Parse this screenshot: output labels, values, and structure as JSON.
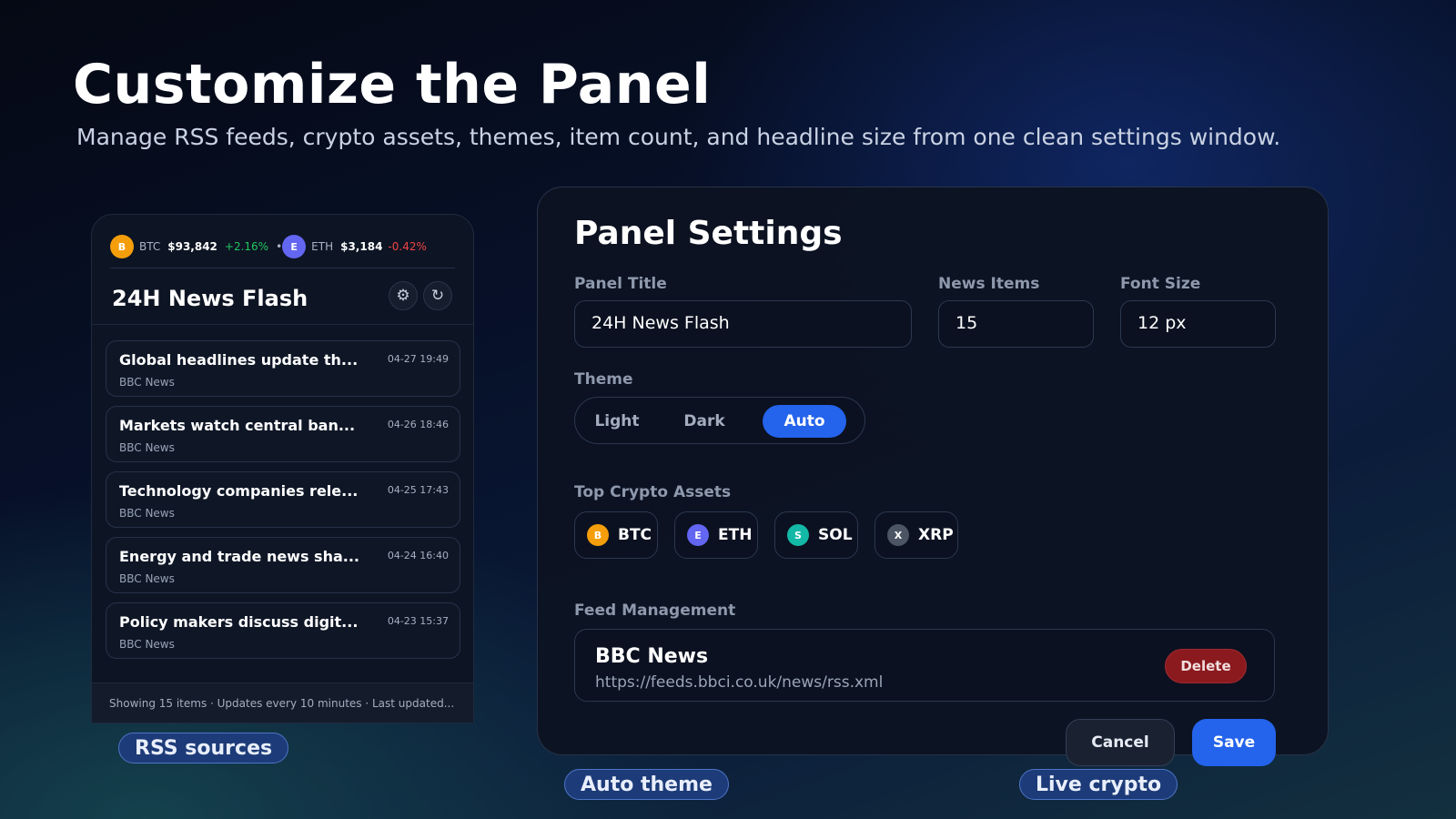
{
  "hero": {
    "title": "Customize the Panel",
    "subtitle": "Manage RSS feeds, crypto assets, themes, item count, and headline size from one clean settings window."
  },
  "widget": {
    "ticker": [
      {
        "badge": "B",
        "symbol": "BTC",
        "price": "$93,842",
        "change": "+2.16%",
        "direction": "up",
        "color": "#f59e0b"
      },
      {
        "badge": "E",
        "symbol": "ETH",
        "price": "$3,184",
        "change": "-0.42%",
        "direction": "down",
        "color": "#6366f1"
      }
    ],
    "ticker_separator": "•",
    "title": "24H News Flash",
    "settings_icon": "⚙",
    "refresh_icon": "↻",
    "news": [
      {
        "title": "Global headlines update th...",
        "source": "BBC News",
        "time": "04-27 19:49"
      },
      {
        "title": "Markets watch central ban...",
        "source": "BBC News",
        "time": "04-26 18:46"
      },
      {
        "title": "Technology companies rele...",
        "source": "BBC News",
        "time": "04-25 17:43"
      },
      {
        "title": "Energy and trade news sha...",
        "source": "BBC News",
        "time": "04-24 16:40"
      },
      {
        "title": "Policy makers discuss digit...",
        "source": "BBC News",
        "time": "04-23 15:37"
      }
    ],
    "footer": "Showing 15 items · Updates every 10 minutes · Last updated..."
  },
  "pills": {
    "rss": "RSS sources",
    "theme": "Auto theme",
    "crypto": "Live crypto"
  },
  "settings": {
    "title": "Panel Settings",
    "panel_title_label": "Panel Title",
    "panel_title_value": "24H News Flash",
    "news_items_label": "News Items",
    "news_items_value": "15",
    "font_size_label": "Font Size",
    "font_size_value": "12 px",
    "theme_label": "Theme",
    "theme_options": [
      "Light",
      "Dark",
      "Auto"
    ],
    "theme_selected": "Auto",
    "assets_label": "Top Crypto Assets",
    "assets": [
      {
        "badge": "B",
        "symbol": "BTC",
        "color": "#f59e0b"
      },
      {
        "badge": "E",
        "symbol": "ETH",
        "color": "#6366f1"
      },
      {
        "badge": "S",
        "symbol": "SOL",
        "color": "#14b8a6"
      },
      {
        "badge": "X",
        "symbol": "XRP",
        "color": "#4b5563"
      }
    ],
    "feed_label": "Feed Management",
    "feed": {
      "name": "BBC News",
      "url": "https://feeds.bbci.co.uk/news/rss.xml",
      "delete_label": "Delete"
    },
    "cancel_label": "Cancel",
    "save_label": "Save"
  }
}
